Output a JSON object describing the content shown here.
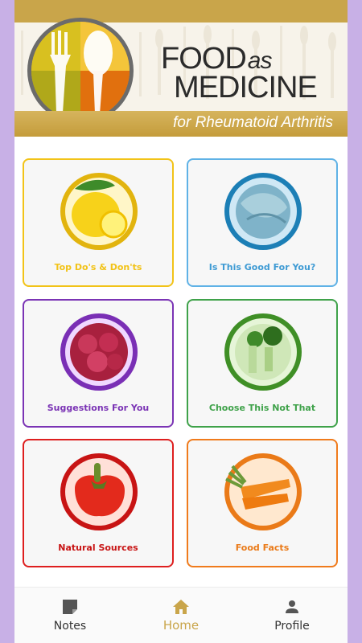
{
  "header": {
    "title_line1": "FOOD",
    "title_as": "as",
    "title_line2": "MEDICINE",
    "subtitle": "for Rheumatoid Arthritis"
  },
  "cards": [
    {
      "label": "Top Do's & Don'ts",
      "color": "#f2c318",
      "icon": "lemon-icon"
    },
    {
      "label": "Is This Good For You?",
      "color": "#5fb2e6",
      "icon": "cabbage-icon"
    },
    {
      "label": "Suggestions For You",
      "color": "#7b34b5",
      "icon": "raspberry-icon"
    },
    {
      "label": "Choose This Not That",
      "color": "#3fa24a",
      "icon": "broccoli-icon"
    },
    {
      "label": "Natural Sources",
      "color": "#de1f1f",
      "icon": "pepper-icon"
    },
    {
      "label": "Food Facts",
      "color": "#f07b1c",
      "icon": "carrot-icon"
    }
  ],
  "nav": {
    "items": [
      {
        "label": "Notes",
        "icon": "note-icon",
        "active": false
      },
      {
        "label": "Home",
        "icon": "home-icon",
        "active": true
      },
      {
        "label": "Profile",
        "icon": "person-icon",
        "active": false
      }
    ]
  },
  "colors": {
    "gold": "#c9a54a",
    "background": "#c8b0e6"
  }
}
